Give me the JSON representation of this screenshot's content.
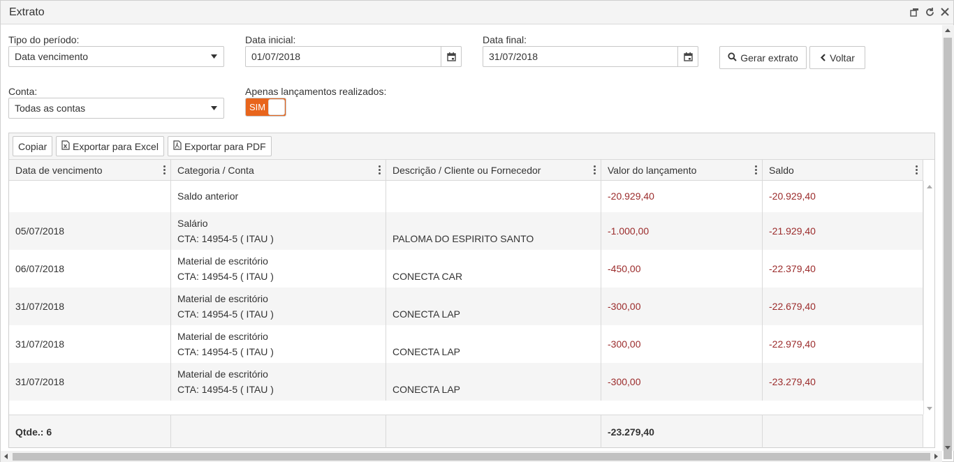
{
  "window": {
    "title": "Extrato"
  },
  "filters": {
    "periodo_label": "Tipo do período:",
    "periodo_value": "Data vencimento",
    "data_inicial_label": "Data inicial:",
    "data_inicial_value": "01/07/2018",
    "data_final_label": "Data final:",
    "data_final_value": "31/07/2018",
    "conta_label": "Conta:",
    "conta_value": "Todas as contas",
    "apenas_label": "Apenas lançamentos realizados:",
    "toggle_label": "SIM",
    "toggle_on": true
  },
  "actions": {
    "gerar_label": "Gerar extrato",
    "voltar_label": "Voltar"
  },
  "toolbar": {
    "copiar": "Copiar",
    "excel": "Exportar para Excel",
    "pdf": "Exportar para PDF"
  },
  "columns": [
    "Data de vencimento",
    "Categoria / Conta",
    "Descrição / Cliente ou Fornecedor",
    "Valor do lançamento",
    "Saldo"
  ],
  "rows": [
    {
      "data": "",
      "categoria": "Saldo anterior",
      "conta": "",
      "descricao": "",
      "valor": "-20.929,40",
      "saldo": "-20.929,40"
    },
    {
      "data": "05/07/2018",
      "categoria": "Salário",
      "conta": "CTA: 14954-5 ( ITAU )",
      "descricao": "PALOMA DO ESPIRITO SANTO",
      "valor": "-1.000,00",
      "saldo": "-21.929,40"
    },
    {
      "data": "06/07/2018",
      "categoria": "Material de escritório",
      "conta": "CTA: 14954-5 ( ITAU )",
      "descricao": "CONECTA CAR",
      "valor": "-450,00",
      "saldo": "-22.379,40"
    },
    {
      "data": "31/07/2018",
      "categoria": "Material de escritório",
      "conta": "CTA: 14954-5 ( ITAU )",
      "descricao": "CONECTA LAP",
      "valor": "-300,00",
      "saldo": "-22.679,40"
    },
    {
      "data": "31/07/2018",
      "categoria": "Material de escritório",
      "conta": "CTA: 14954-5 ( ITAU )",
      "descricao": "CONECTA LAP",
      "valor": "-300,00",
      "saldo": "-22.979,40"
    },
    {
      "data": "31/07/2018",
      "categoria": "Material de escritório",
      "conta": "CTA: 14954-5 ( ITAU )",
      "descricao": "CONECTA LAP",
      "valor": "-300,00",
      "saldo": "-23.279,40"
    }
  ],
  "footer": {
    "qtde": "Qtde.: 6",
    "total": "-23.279,40"
  },
  "colors": {
    "accent": "#e8651c",
    "negative": "#9b2b2b"
  }
}
